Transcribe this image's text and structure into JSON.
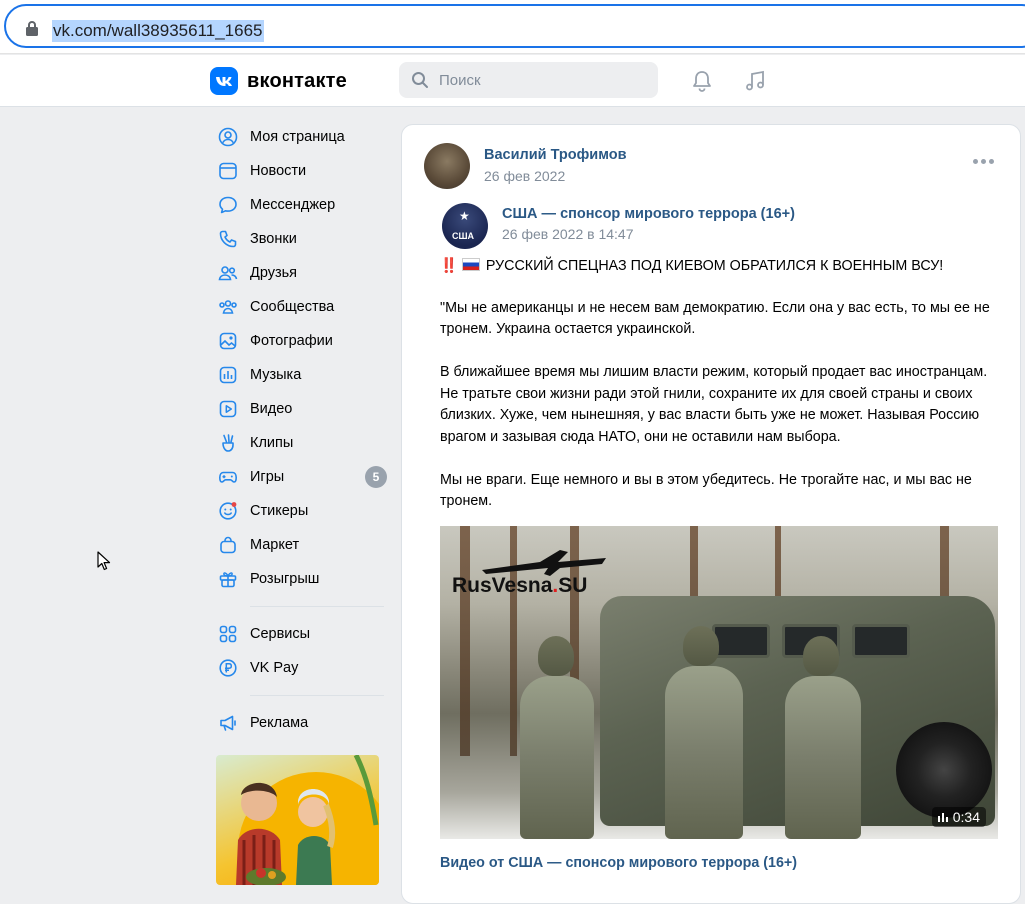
{
  "browser": {
    "url": "vk.com/wall38935611_1665"
  },
  "header": {
    "logo_text": "вконтакте",
    "logo_mark": "vk",
    "search_placeholder": "Поиск",
    "icons": [
      "bell-icon",
      "music-note-icon"
    ]
  },
  "sidebar": {
    "items": [
      {
        "label": "Моя страница",
        "icon": "user-circle-icon"
      },
      {
        "label": "Новости",
        "icon": "news-icon"
      },
      {
        "label": "Мессенджер",
        "icon": "message-bubble-icon"
      },
      {
        "label": "Звонки",
        "icon": "phone-icon"
      },
      {
        "label": "Друзья",
        "icon": "friends-icon"
      },
      {
        "label": "Сообщества",
        "icon": "communities-icon"
      },
      {
        "label": "Фотографии",
        "icon": "photo-icon"
      },
      {
        "label": "Музыка",
        "icon": "music-icon"
      },
      {
        "label": "Видео",
        "icon": "video-icon"
      },
      {
        "label": "Клипы",
        "icon": "clips-icon"
      },
      {
        "label": "Игры",
        "icon": "gamepad-icon",
        "badge": "5"
      },
      {
        "label": "Стикеры",
        "icon": "sticker-icon"
      },
      {
        "label": "Маркет",
        "icon": "bag-icon"
      },
      {
        "label": "Розыгрыш",
        "icon": "gift-icon"
      }
    ],
    "secondary": [
      {
        "label": "Сервисы",
        "icon": "services-icon"
      },
      {
        "label": "VK Pay",
        "icon": "ruble-icon"
      }
    ],
    "tertiary": [
      {
        "label": "Реклама",
        "icon": "megaphone-icon"
      }
    ]
  },
  "post": {
    "author_name": "Василий Трофимов",
    "date": "26 фев 2022",
    "repost": {
      "source_name": "США — спонсор мирового террора (16+)",
      "source_date": "26 фев 2022 в 14:47",
      "avatar_text": "США"
    },
    "headline": "РУССКИЙ СПЕЦНАЗ ПОД КИЕВОМ ОБРАТИЛСЯ К ВОЕННЫМ ВСУ!",
    "headline_prefix": "‼️",
    "paragraphs": [
      "\"Мы не американцы и не несем вам демократию. Если она у вас есть, то мы ее не тронем. Украина остается украинской.",
      "В ближайшее время мы лишим власти режим, который продает вас иностранцам. Не тратьте свои жизни ради этой гнили, сохраните их для своей страны и своих близких. Хуже, чем нынешняя, у вас власти быть уже не может. Называя Россию врагом и зазывая сюда НАТО, они не оставили нам выбора.",
      "Мы не враги. Еще немного и вы в этом убедитесь. Не трогайте нас, и мы вас не тронем."
    ],
    "video": {
      "watermark_prefix": "RusVesna",
      "watermark_dot": ".",
      "watermark_suffix": "SU",
      "duration": "0:34",
      "caption": "Видео от США — спонсор мирового террора (16+)"
    }
  },
  "colors": {
    "link": "#2a5885",
    "accent": "#0077ff",
    "page_bg": "#edeef0",
    "muted": "#818c99"
  }
}
